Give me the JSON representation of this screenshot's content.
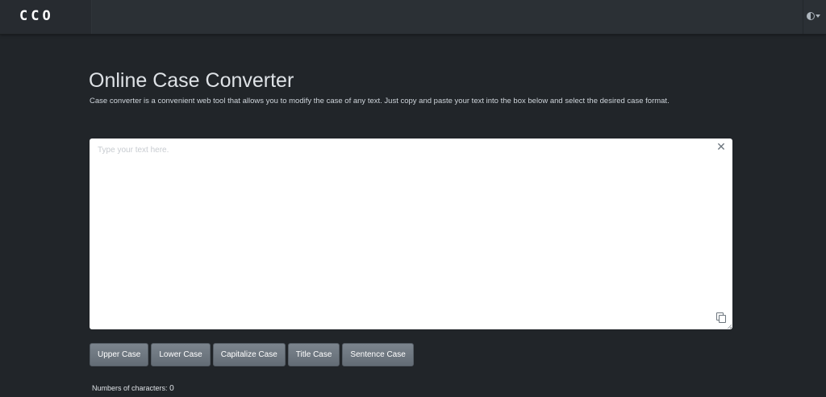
{
  "navbar": {
    "logo_letters": [
      "C",
      "C",
      "O"
    ],
    "theme_toggle_icon": "half-circle-icon",
    "dropdown_icon": "caret-down-icon"
  },
  "main": {
    "title": "Online Case Converter",
    "description": "Case converter is a convenient web tool that allows you to modify the case of any text. Just copy and paste your text into the box below and select the desired case format."
  },
  "editor": {
    "placeholder": "Type your text here.",
    "value": "",
    "close_icon": "close-icon",
    "copy_icon": "copy-icon"
  },
  "buttons": {
    "upper": "Upper Case",
    "lower": "Lower Case",
    "capitalize": "Capitalize Case",
    "title": "Title Case",
    "sentence": "Sentence Case"
  },
  "stats": {
    "label": "Numbers of characters:",
    "count": "0"
  },
  "colors": {
    "page_background": "#212529",
    "navbar_background": "#2b3035",
    "button_background": "#6c757d",
    "text_primary": "#dee2e6"
  }
}
